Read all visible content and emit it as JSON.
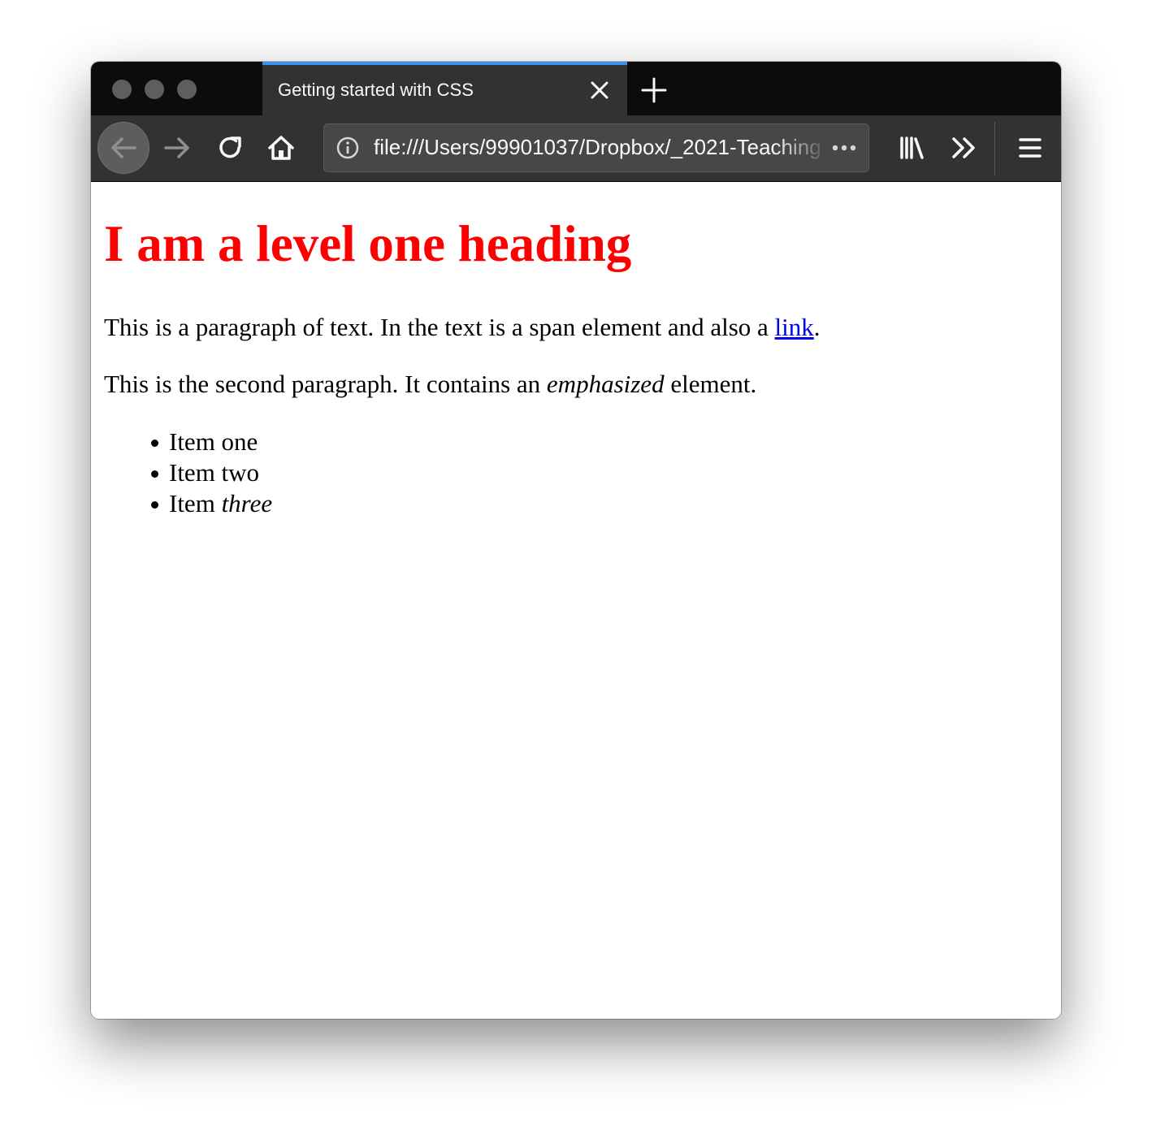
{
  "browser": {
    "tab": {
      "title": "Getting started with CSS"
    },
    "urlbar": {
      "url": "file:///Users/99901037/Dropbox/_2021-Teaching"
    },
    "colors": {
      "tabbar": "#0c0c0d",
      "toolbar": "#323234",
      "active_tab_accent": "#3d8ff0"
    },
    "icons": {
      "back": "arrow-left-icon",
      "forward": "arrow-right-icon",
      "reload": "reload-icon",
      "home": "home-icon",
      "info": "info-icon",
      "page_actions": "ellipsis-icon",
      "library": "library-icon",
      "overflow": "chevron-double-right-icon",
      "menu": "hamburger-menu-icon",
      "close_tab": "close-icon",
      "new_tab": "plus-icon"
    }
  },
  "page": {
    "heading": "I am a level one heading",
    "heading_color": "#ff0000",
    "paragraph1": {
      "before": "This is a paragraph of text. In the text is a span element and also a ",
      "link": "link",
      "after": "."
    },
    "paragraph2": {
      "before": "This is the second paragraph. It contains an ",
      "emphasis": "emphasized",
      "after": " element."
    },
    "list": {
      "item1": "Item one",
      "item2": "Item two",
      "item3_prefix": "Item ",
      "item3_emphasis": "three"
    }
  }
}
